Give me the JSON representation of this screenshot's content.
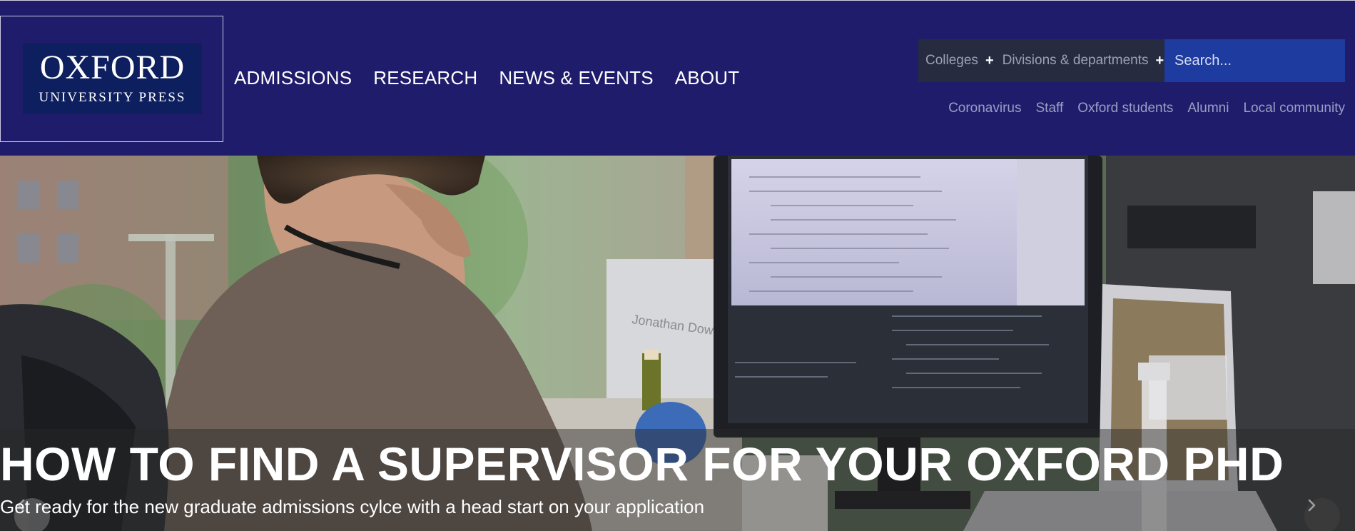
{
  "logo": {
    "main": "OXFORD",
    "sub": "UNIVERSITY PRESS"
  },
  "main_nav": [
    "ADMISSIONS",
    "RESEARCH",
    "NEWS & EVENTS",
    "ABOUT"
  ],
  "utility": {
    "colleges_label": "Colleges",
    "divisions_label": "Divisions & departments",
    "search_placeholder": "Search..."
  },
  "quick_links": [
    "Coronavirus",
    "Staff",
    "Oxford students",
    "Alumni",
    "Local community"
  ],
  "hero": {
    "title": "HOW TO FIND A SUPERVISOR FOR YOUR OXFORD PHD",
    "subtitle": "Get ready for the new graduate admissions cylce with a head start on your application",
    "monitor_text": "Jonathan Dow"
  },
  "colors": {
    "header_bg": "#1f1c6b",
    "util_bar": "#262b40",
    "search_bg": "#1e3c9f",
    "logo_bg": "#0d1f5e"
  }
}
